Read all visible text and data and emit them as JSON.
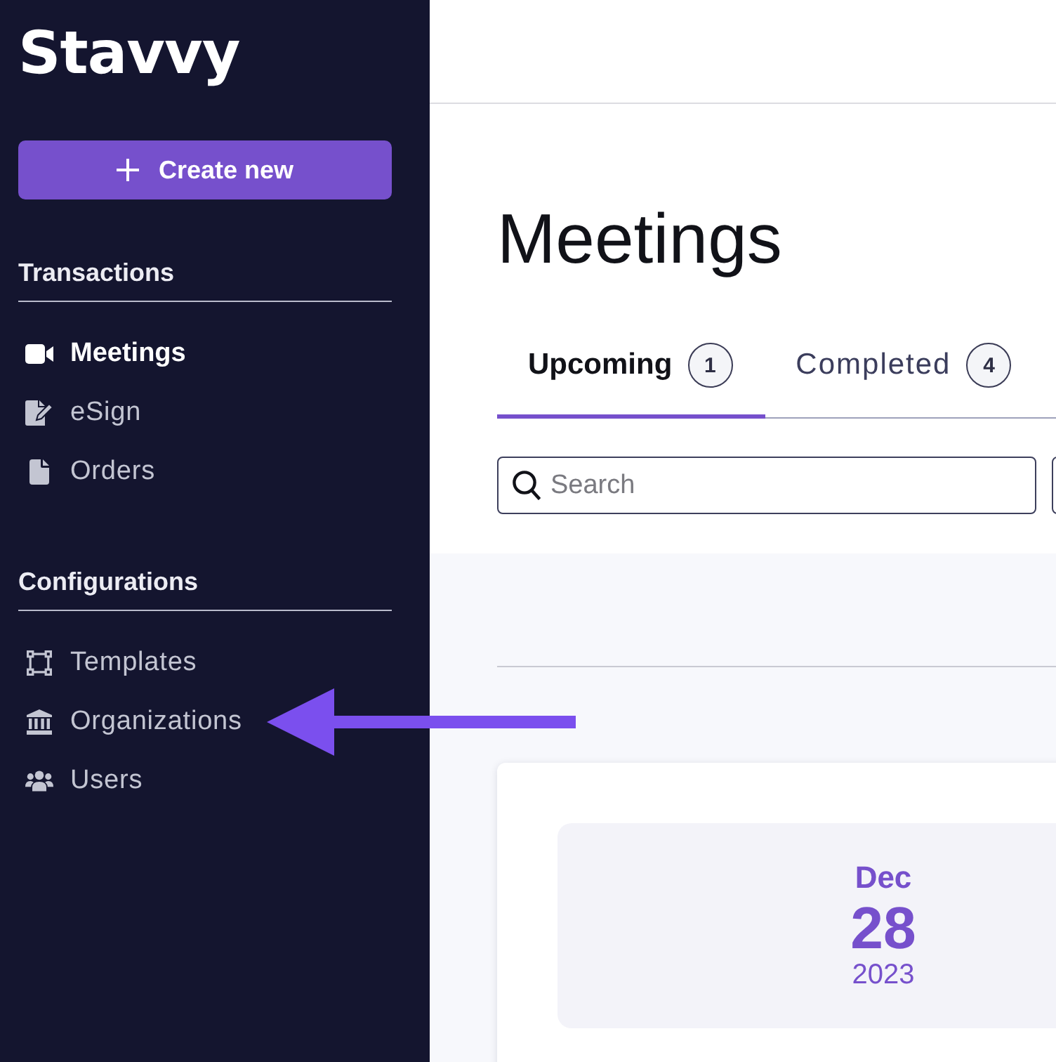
{
  "sidebar": {
    "logo": "Stavvy",
    "create_button": {
      "label": "Create new"
    },
    "sections": [
      {
        "title": "Transactions",
        "items": [
          {
            "label": "Meetings",
            "selected": true
          },
          {
            "label": "eSign",
            "selected": false
          },
          {
            "label": "Orders",
            "selected": false
          }
        ]
      },
      {
        "title": "Configurations",
        "items": [
          {
            "label": "Templates",
            "selected": false
          },
          {
            "label": "Organizations",
            "selected": false
          },
          {
            "label": "Users",
            "selected": false
          }
        ]
      }
    ]
  },
  "page": {
    "title": "Meetings",
    "tabs": [
      {
        "label": "Upcoming",
        "count": "1",
        "selected": true
      },
      {
        "label": "Completed",
        "count": "4",
        "selected": false
      }
    ],
    "search": {
      "placeholder": "Search"
    },
    "meetings": [
      {
        "month": "Dec",
        "day": "28",
        "year": "2023"
      }
    ]
  }
}
